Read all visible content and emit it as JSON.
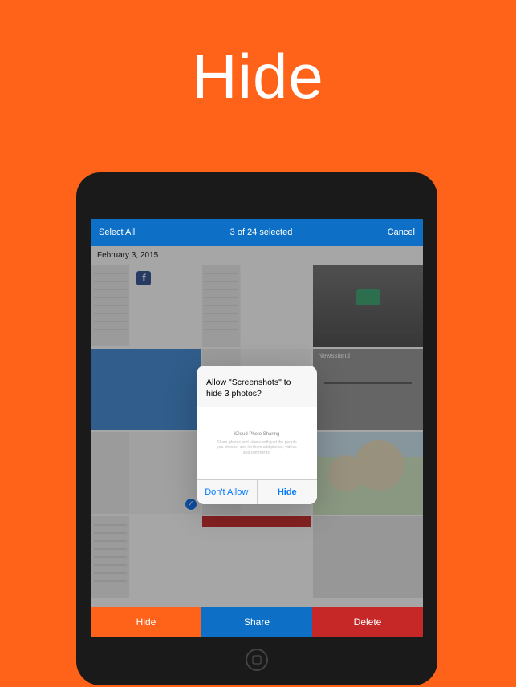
{
  "page": {
    "title": "Hide"
  },
  "navbar": {
    "left": "Select All",
    "center": "3 of 24 selected",
    "right": "Cancel"
  },
  "date_header": "February 3, 2015",
  "newsstand_label": "Newsstand",
  "alert": {
    "title": "Allow \"Screenshots\" to hide 3 photos?",
    "body_title": "iCloud Photo Sharing",
    "body_text": "Share photos and videos with just the people you choose, and let them add photos, videos and comments.",
    "dont_allow": "Don't Allow",
    "hide": "Hide"
  },
  "toolbar": {
    "hide": "Hide",
    "share": "Share",
    "delete": "Delete"
  }
}
